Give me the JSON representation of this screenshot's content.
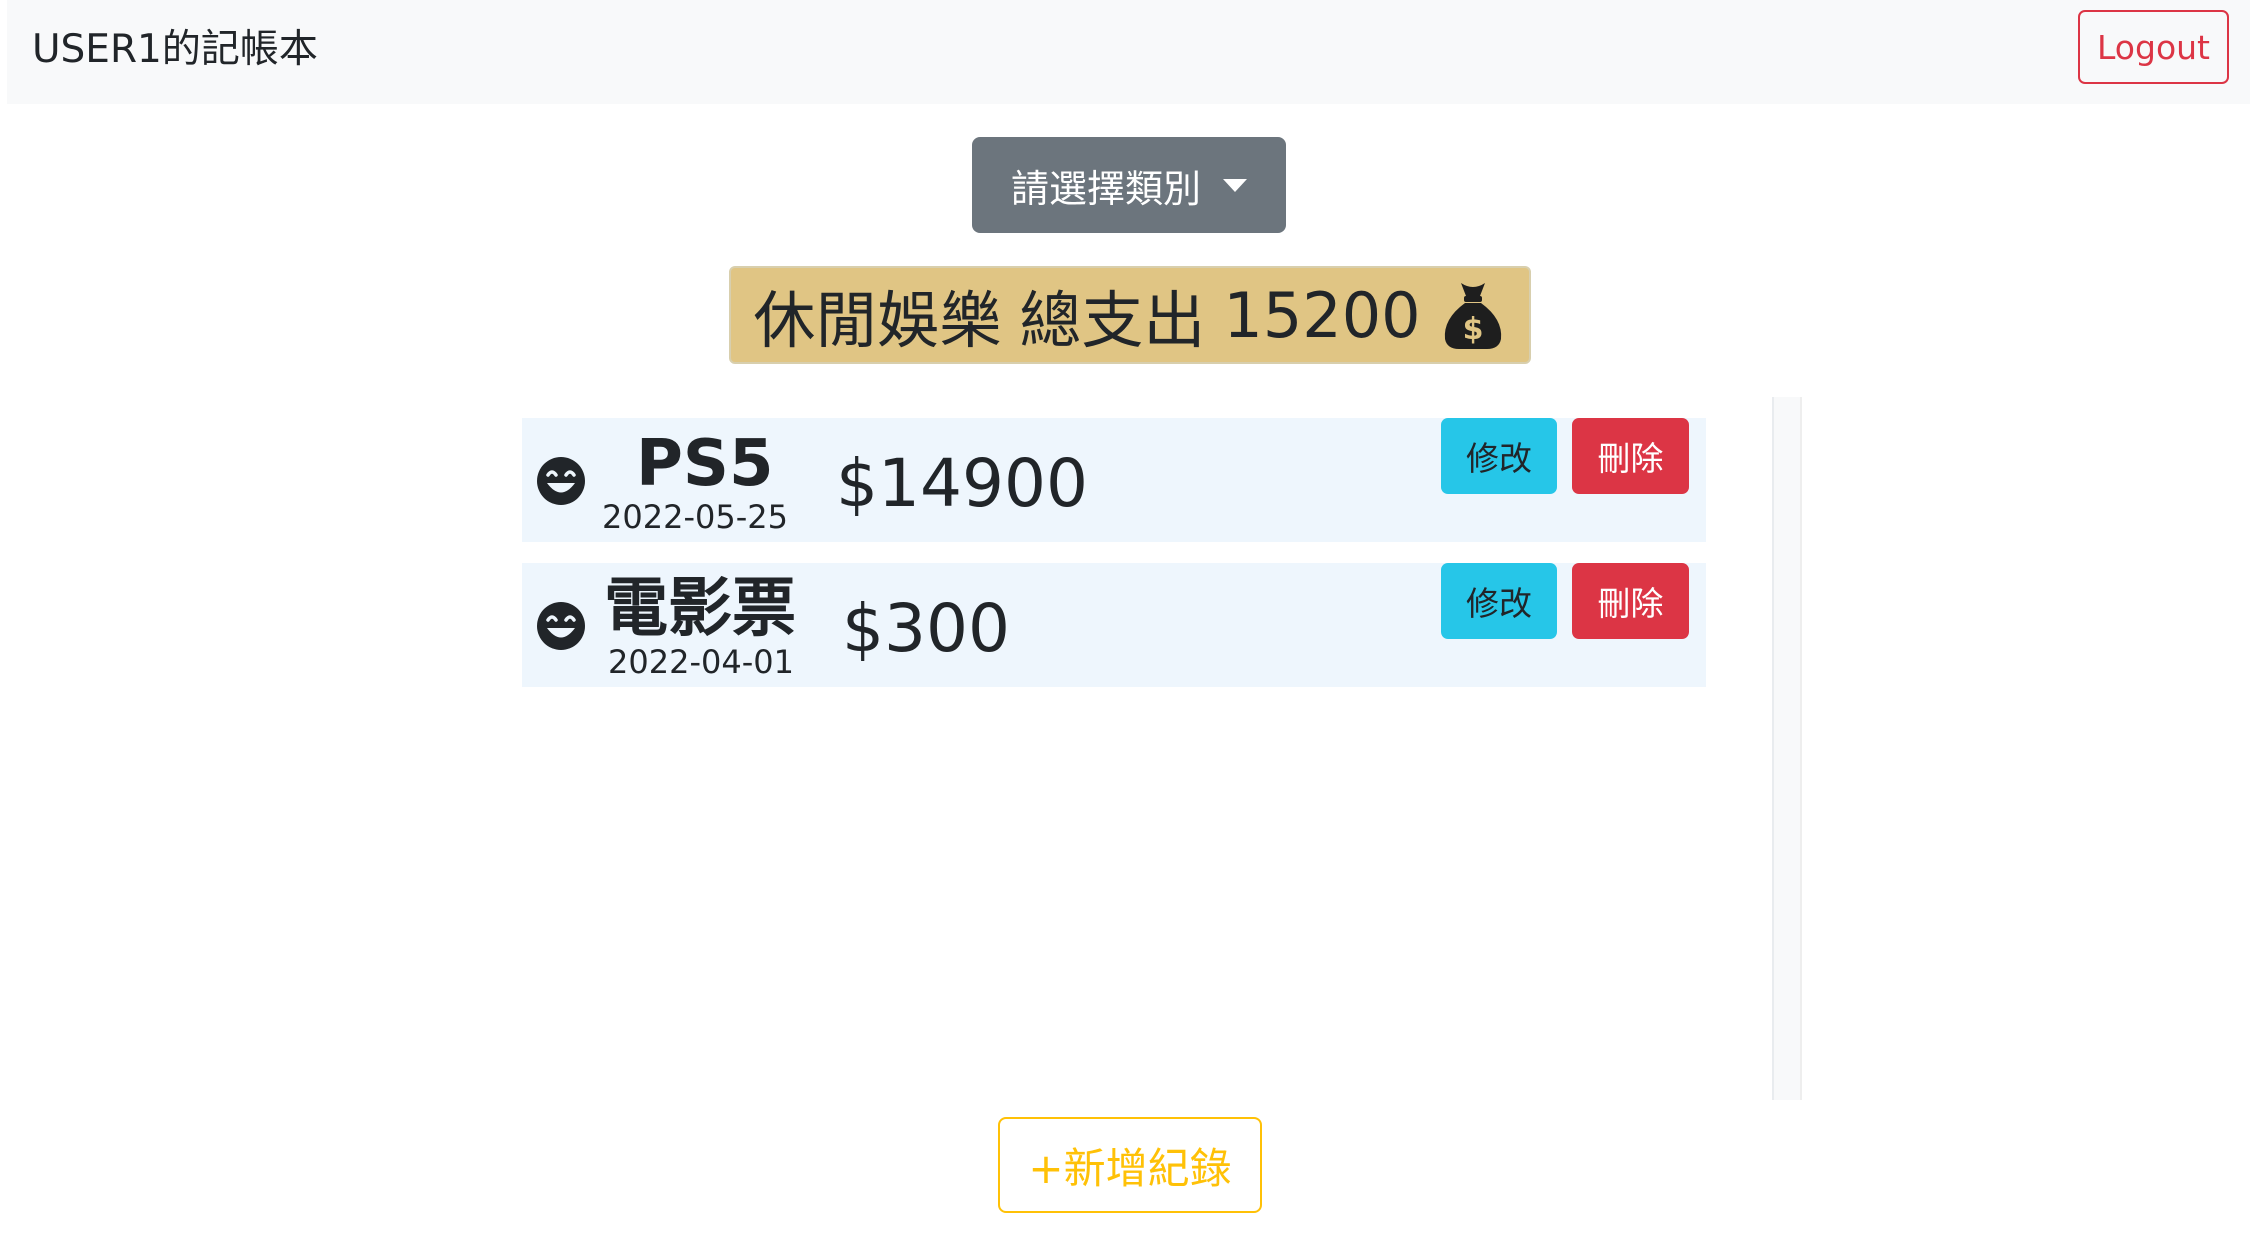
{
  "navbar": {
    "brand": "USER1的記帳本",
    "logout_label": "Logout"
  },
  "category_dropdown": {
    "label": "請選擇類別"
  },
  "summary": {
    "category": "休閒娛樂",
    "total_label": "總支出",
    "total_value": "15200",
    "icon": "money-bag-icon"
  },
  "records": [
    {
      "icon": "smile-icon",
      "name": "PS5",
      "date": "2022-05-25",
      "price": "$14900",
      "edit_label": "修改",
      "delete_label": "刪除"
    },
    {
      "icon": "smile-icon",
      "name": "電影票",
      "date": "2022-04-01",
      "price": "$300",
      "edit_label": "修改",
      "delete_label": "刪除"
    }
  ],
  "add_button": {
    "label": "+新增紀錄"
  },
  "colors": {
    "navbar_bg": "#f8f9fa",
    "danger": "#dc3545",
    "info": "#26c6e8",
    "secondary": "#6c757d",
    "warning": "#ffc107",
    "summary_bg": "#e0c584",
    "record_bg": "#eef6fd"
  }
}
